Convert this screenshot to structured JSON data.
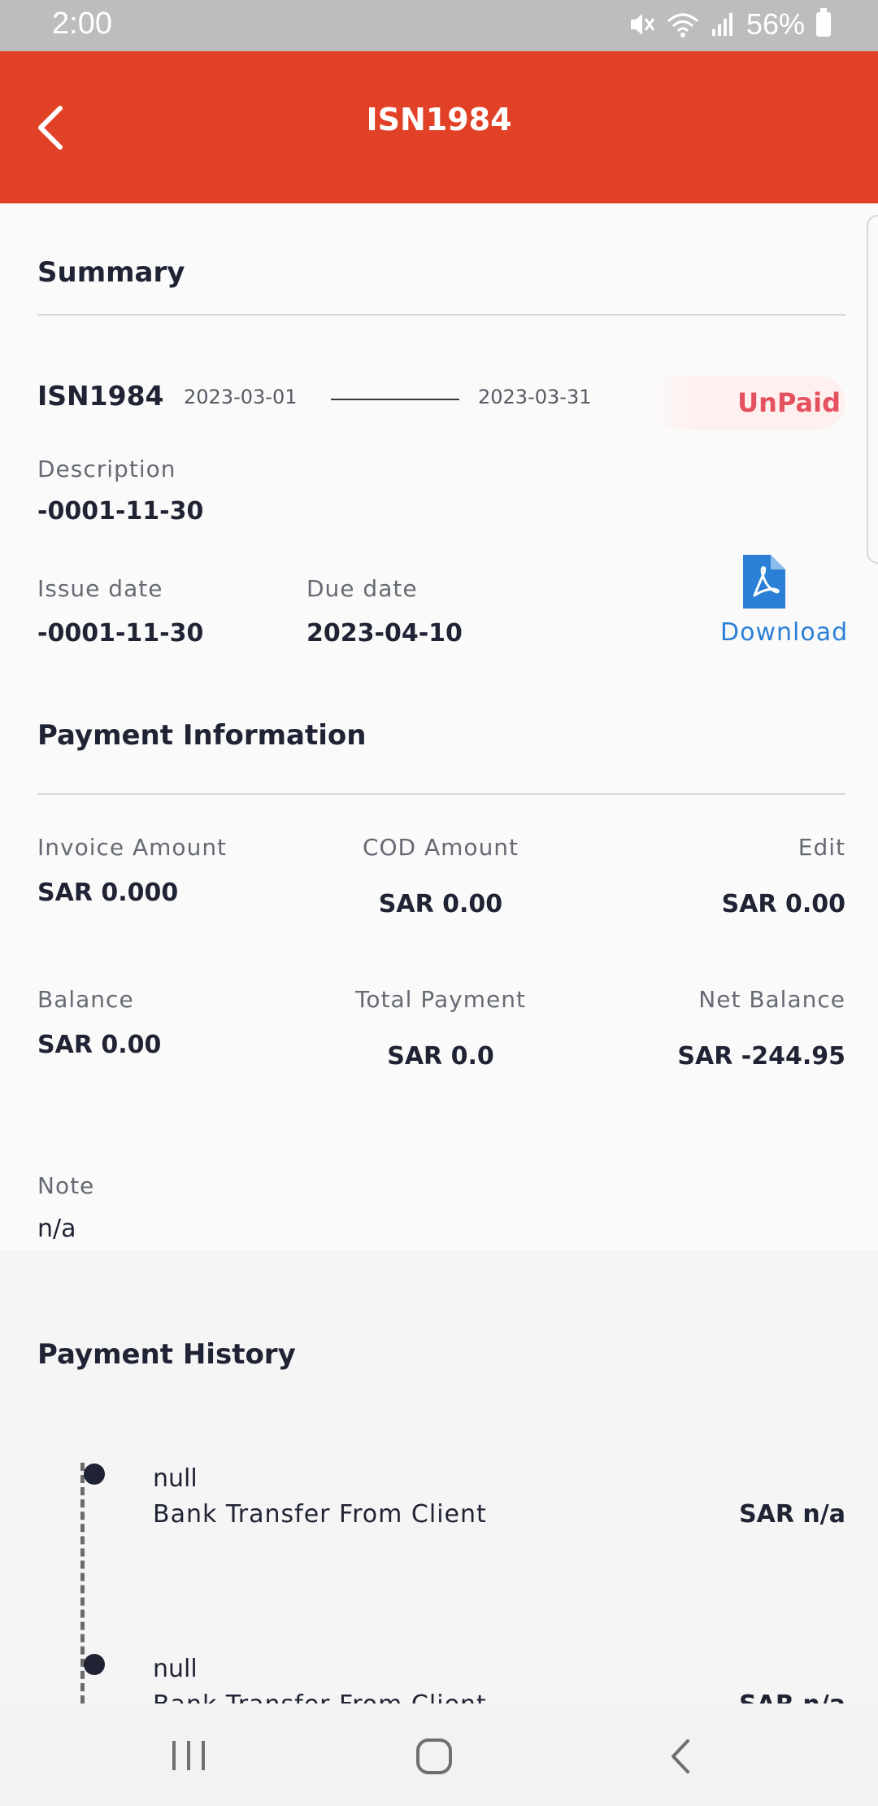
{
  "status_bar": {
    "time": "2:00",
    "battery": "56%",
    "icons": [
      "mute-icon",
      "wifi-icon",
      "signal-icon",
      "battery-icon"
    ]
  },
  "app_bar": {
    "title": "ISN1984",
    "back_icon": "chevron-left-icon",
    "color": "#e14127"
  },
  "summary": {
    "section_title": "Summary",
    "invoice_id": "ISN1984",
    "period_start": "2023-03-01",
    "period_end": "2023-03-31",
    "status": "UnPaid",
    "status_color": "#e5525f",
    "description_label": "Description",
    "description_value": "-0001-11-30",
    "issue_date_label": "Issue date",
    "issue_date_value": "-0001-11-30",
    "due_date_label": "Due date",
    "due_date_value": "2023-04-10",
    "download_label": "Download",
    "download_icon": "pdf-file-icon",
    "download_color": "#2b7fd6"
  },
  "payment_info": {
    "section_title": "Payment Information",
    "invoice_amount_label": "Invoice Amount",
    "invoice_amount_value": "SAR 0.000",
    "cod_amount_label": "COD Amount",
    "cod_amount_value": "SAR 0.00",
    "edit_label": "Edit",
    "edit_value": "SAR 0.00",
    "balance_label": "Balance",
    "balance_value": "SAR 0.00",
    "total_payment_label": "Total Payment",
    "total_payment_value": "SAR 0.0",
    "net_balance_label": "Net Balance",
    "net_balance_value": "SAR -244.95",
    "note_label": "Note",
    "note_value": "n/a"
  },
  "payment_history": {
    "section_title": "Payment History",
    "items": [
      {
        "title": "null",
        "method": "Bank Transfer From Client",
        "amount": "SAR n/a"
      },
      {
        "title": "null",
        "method": "Bank Transfer From Client",
        "amount": "SAR n/a"
      }
    ]
  },
  "nav_bar": {
    "icons": [
      "recent-apps-icon",
      "home-icon",
      "back-nav-icon"
    ]
  }
}
